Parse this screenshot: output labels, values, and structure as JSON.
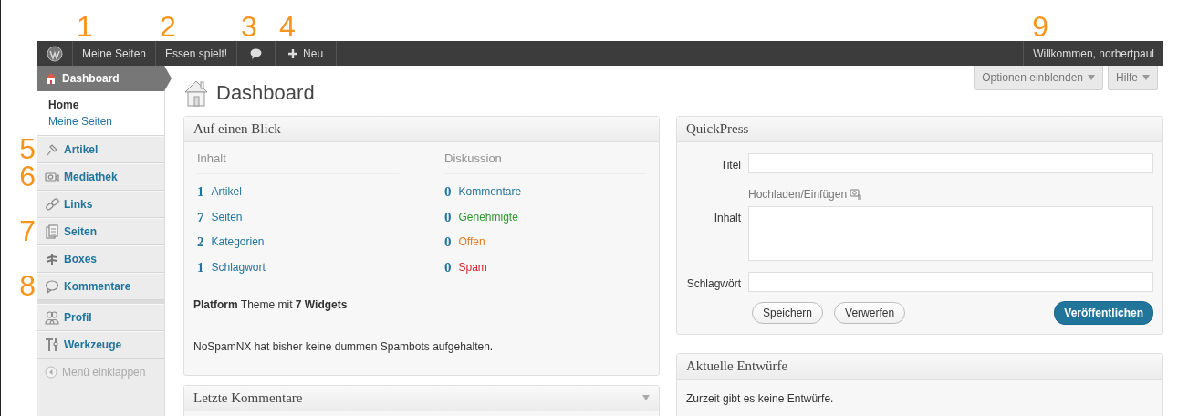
{
  "admin_bar": {
    "items": [
      {
        "kind": "logo"
      },
      {
        "kind": "text",
        "label": "Meine Seiten",
        "callout": "1"
      },
      {
        "kind": "text",
        "label": "Essen spielt!",
        "callout": "2"
      },
      {
        "kind": "comments",
        "callout": "3"
      },
      {
        "kind": "new",
        "label": "Neu",
        "callout": "4"
      }
    ],
    "welcome": {
      "label": "Willkommen, norbertpaul",
      "callout": "9"
    }
  },
  "sidebar": {
    "items": [
      {
        "kind": "menu",
        "label": "Dashboard",
        "selected": true,
        "children": [
          {
            "label": "Home",
            "selected": true
          },
          {
            "label": "Meine Seiten",
            "selected": false
          }
        ]
      },
      {
        "kind": "menu",
        "label": "Artikel",
        "selected": false,
        "callout": "5"
      },
      {
        "kind": "menu",
        "label": "Mediathek",
        "selected": false,
        "callout": "6"
      },
      {
        "kind": "menu",
        "label": "Links",
        "selected": false
      },
      {
        "kind": "menu",
        "label": "Seiten",
        "selected": false,
        "callout": "7"
      },
      {
        "kind": "menu",
        "label": "Boxes",
        "selected": false
      },
      {
        "kind": "menu",
        "label": "Kommentare",
        "selected": false,
        "callout": "8"
      },
      {
        "kind": "separator"
      },
      {
        "kind": "menu",
        "label": "Profil",
        "selected": false
      },
      {
        "kind": "menu",
        "label": "Werkzeuge",
        "selected": false
      },
      {
        "kind": "collapse",
        "label": "Menü einklappen"
      }
    ]
  },
  "screen_options": [
    "Optionen einblenden",
    "Hilfe"
  ],
  "page_title": "Dashboard",
  "at_a_glance": {
    "title": "Auf einen Blick",
    "columns": [
      {
        "heading": "Inhalt",
        "rows": [
          {
            "count": "1",
            "label": "Artikel",
            "color": "#21759b"
          },
          {
            "count": "7",
            "label": "Seiten",
            "color": "#21759b"
          },
          {
            "count": "2",
            "label": "Kategorien",
            "color": "#21759b"
          },
          {
            "count": "1",
            "label": "Schlagwort",
            "color": "#21759b"
          }
        ]
      },
      {
        "heading": "Diskussion",
        "rows": [
          {
            "count": "0",
            "label": "Kommentare",
            "color": "#21759b"
          },
          {
            "count": "0",
            "label": "Genehmigte",
            "color": "#2a9a2a"
          },
          {
            "count": "0",
            "label": "Offen",
            "color": "#e07b1f"
          },
          {
            "count": "0",
            "label": "Spam",
            "color": "#d8262c"
          }
        ]
      }
    ],
    "theme_line": "**Platform** Theme mit **7 Widgets**",
    "spam_line": "NoSpamNX hat bisher keine dummen Spambots aufgehalten."
  },
  "recent_comments": {
    "title": "Letzte Kommentare"
  },
  "quickpress": {
    "title": "QuickPress",
    "title_label": "Titel",
    "upload_label": "Hochladen/Einfügen",
    "content_label": "Inhalt",
    "tags_label": "Schlagwört",
    "buttons": [
      "Speichern",
      "Verwerfen"
    ],
    "publish": "Veröffentlichen"
  },
  "drafts": {
    "title": "Aktuelle Entwürfe",
    "text": "Zurzeit gibt es keine Entwürfe."
  }
}
